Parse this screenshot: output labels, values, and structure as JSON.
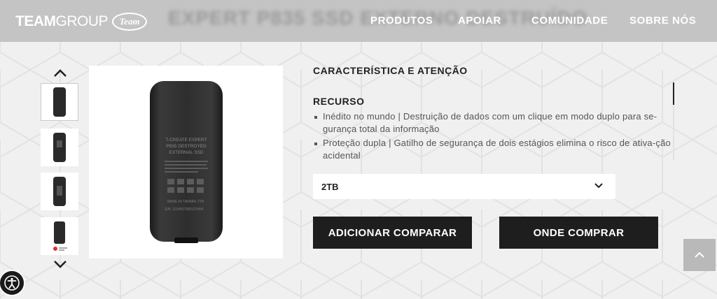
{
  "header": {
    "blurred_title": "EXPERT P835 SSD EXTERNO DESTRUÍDO",
    "logo_text_bold": "TEAM",
    "logo_text_light": "GROUP",
    "logo_badge": "Team",
    "nav": [
      {
        "label": "PRODUTOS"
      },
      {
        "label": "APOIAR"
      },
      {
        "label": "COMUNIDADE"
      },
      {
        "label": "SOBRE NÓS"
      }
    ]
  },
  "gallery": {
    "up_icon": "chevron-up-icon",
    "down_icon": "chevron-down-icon",
    "main_image_lines": [
      "T-CREATE EXPERT",
      "P835 DESTROYED",
      "EXTERNAL SSD"
    ],
    "main_image_small": [
      "MADE IN TAIWAN",
      "2TB",
      "S/N: 1234567890123456"
    ]
  },
  "specs": {
    "heading": "CARACTERÍSTICA E ATENÇÃO",
    "subheading": "RECURSO",
    "items": [
      "Inédito no mundo | Destruição de dados com um clique em modo duplo para se-gurança total da informação",
      "Proteção dupla | Gatilho de segurança de dois estágios elimina o risco de ativa-ção acidental"
    ]
  },
  "capacity": {
    "selected": "2TB"
  },
  "actions": {
    "compare": "ADICIONAR COMPARAR",
    "buy": "ONDE COMPRAR"
  },
  "colors": {
    "topbar": "#c4c4c4",
    "button": "#1e1e1e",
    "background": "#f0f0f0"
  }
}
